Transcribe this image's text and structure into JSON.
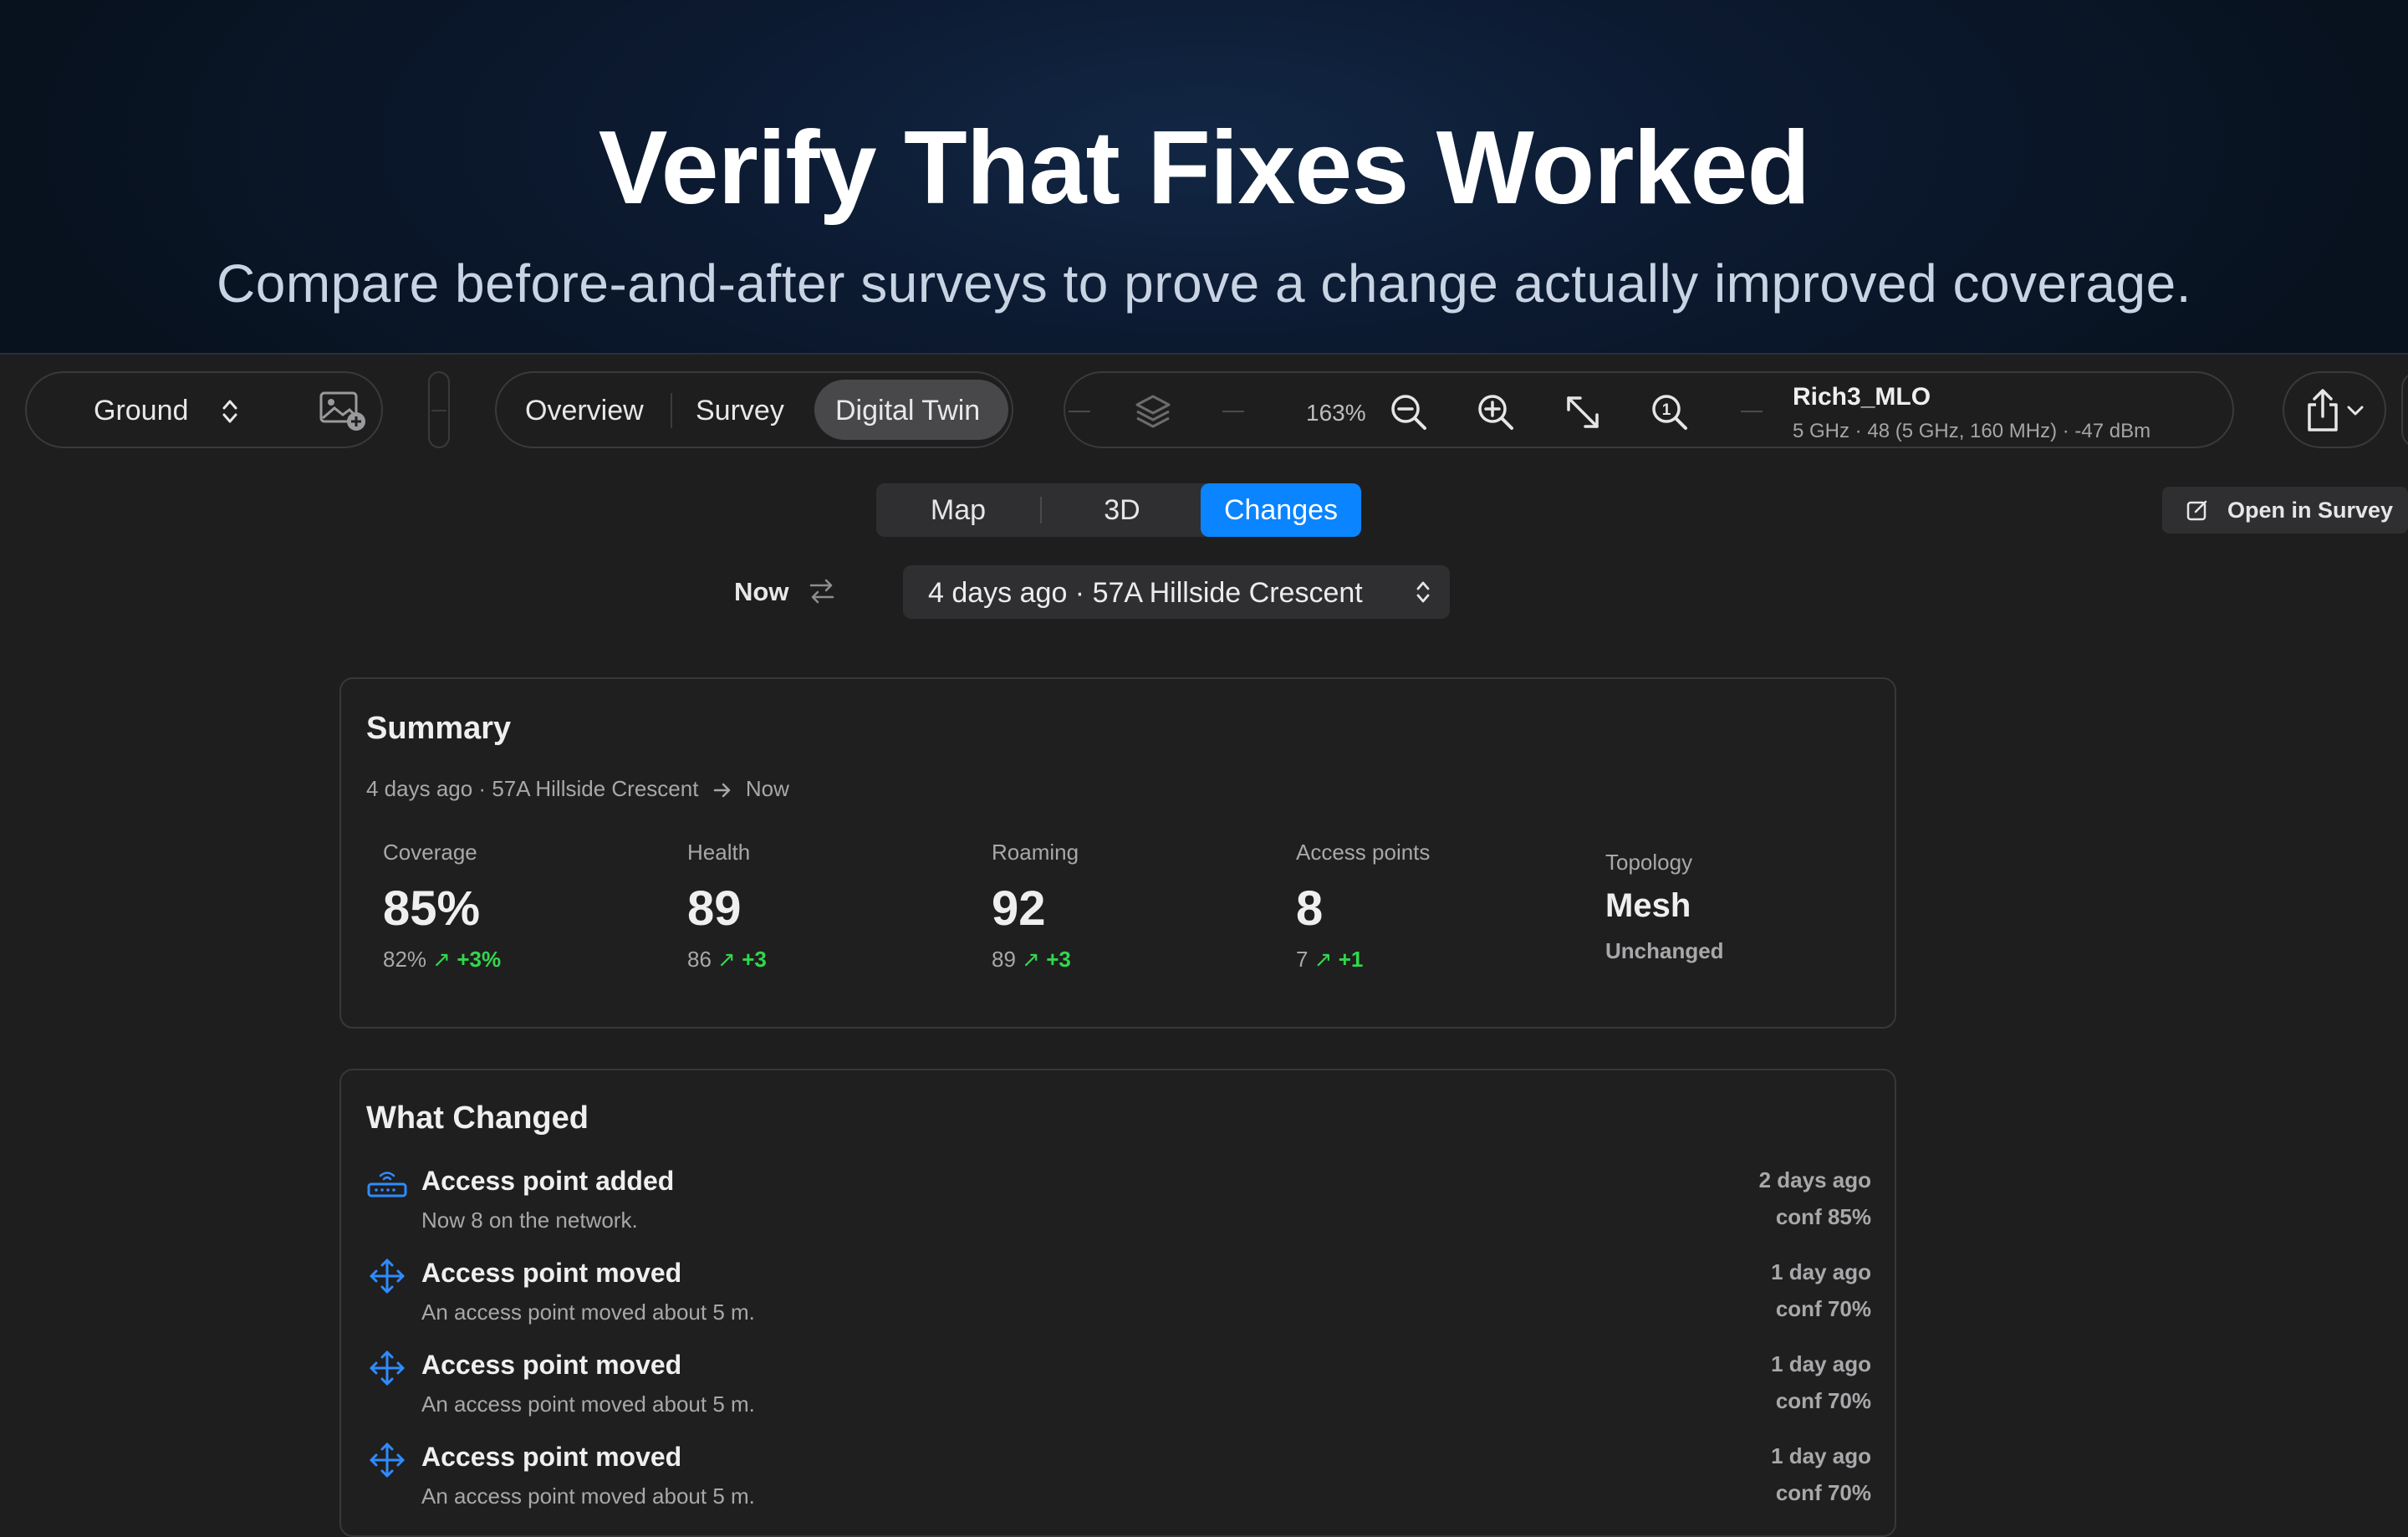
{
  "hero": {
    "title": "Verify That Fixes Worked",
    "subtitle": "Compare before-and-after surveys to prove a change actually improved coverage."
  },
  "toolbar": {
    "floor_label": "Ground",
    "nav": [
      "Overview",
      "Survey",
      "Digital Twin"
    ],
    "nav_active": "Digital Twin",
    "zoom": "163%",
    "network_name": "Rich3_MLO",
    "network_info": "5 GHz · 48 (5 GHz, 160 MHz) · -47 dBm"
  },
  "view_tabs": [
    "Map",
    "3D",
    "Changes"
  ],
  "view_tab_active": "Changes",
  "open_in_survey_label": "Open in Survey",
  "compare": {
    "current": "Now",
    "baseline": "4 days ago · 57A Hillside Crescent"
  },
  "summary": {
    "title": "Summary",
    "range_from": "4 days ago · 57A Hillside Crescent",
    "range_to": "Now",
    "metrics": [
      {
        "label": "Coverage",
        "value": "85%",
        "previous": "82%",
        "delta": "+3%"
      },
      {
        "label": "Health",
        "value": "89",
        "previous": "86",
        "delta": "+3"
      },
      {
        "label": "Roaming",
        "value": "92",
        "previous": "89",
        "delta": "+3"
      },
      {
        "label": "Access points",
        "value": "8",
        "previous": "7",
        "delta": "+1"
      }
    ],
    "topology": {
      "label": "Topology",
      "value": "Mesh",
      "note": "Unchanged"
    }
  },
  "changes": {
    "title": "What Changed",
    "items": [
      {
        "icon": "router-icon",
        "title": "Access point added",
        "desc": "Now 8 on the network.",
        "when": "2 days ago",
        "conf": "conf 85%"
      },
      {
        "icon": "move-arrows-icon",
        "title": "Access point moved",
        "desc": "An access point moved about 5 m.",
        "when": "1 day ago",
        "conf": "conf 70%"
      },
      {
        "icon": "move-arrows-icon",
        "title": "Access point moved",
        "desc": "An access point moved about 5 m.",
        "when": "1 day ago",
        "conf": "conf 70%"
      },
      {
        "icon": "move-arrows-icon",
        "title": "Access point moved",
        "desc": "An access point moved about 5 m.",
        "when": "1 day ago",
        "conf": "conf 70%"
      }
    ]
  },
  "colors": {
    "accent": "#0a84ff",
    "positive": "#32d74b",
    "background": "#1e1e1f"
  }
}
